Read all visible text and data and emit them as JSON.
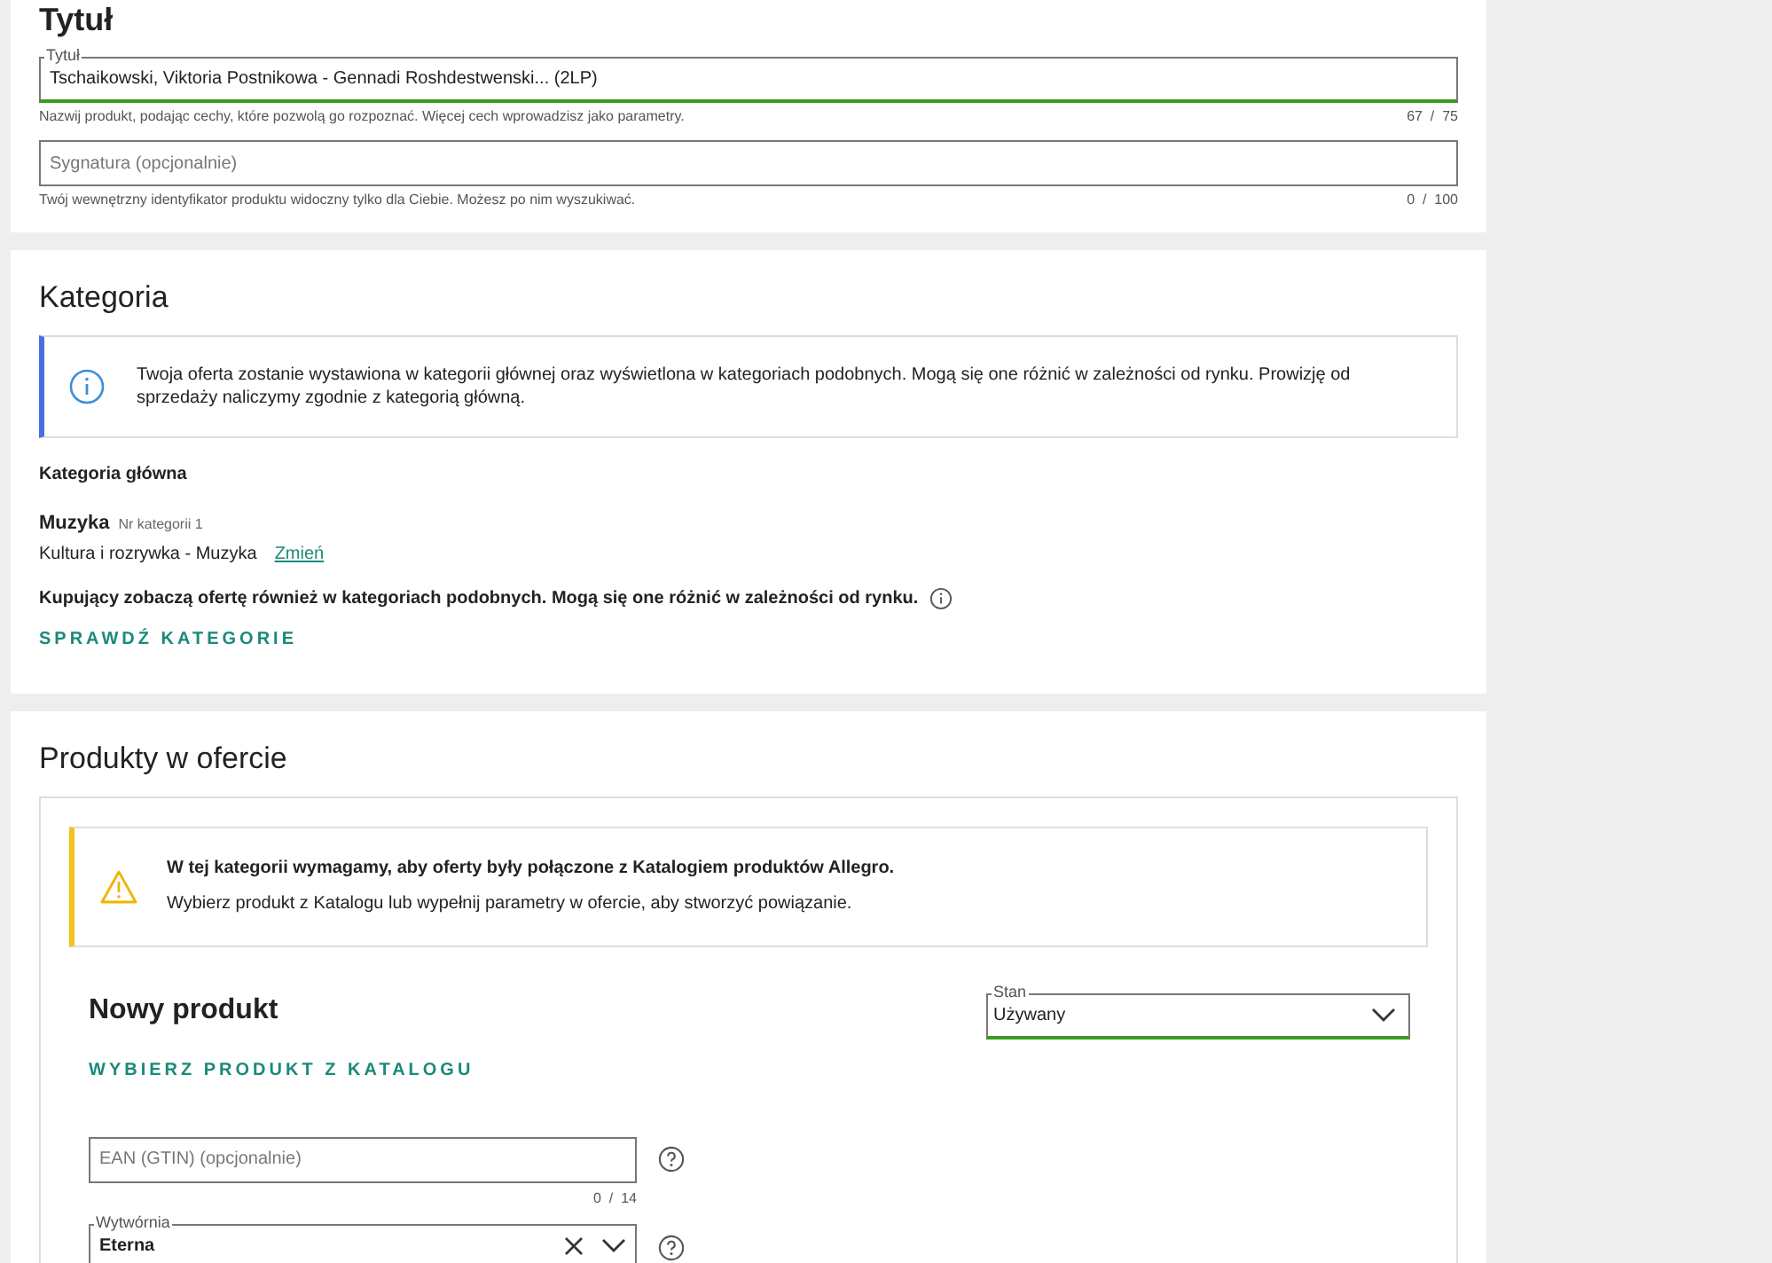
{
  "title_section": {
    "heading": "Tytuł",
    "title_field": {
      "label": "Tytuł",
      "value": "Tschaikowski, Viktoria Postnikowa - Gennadi Roshdestwenski... (2LP)",
      "hint": "Nazwij produkt, podając cechy, które pozwolą go rozpoznać. Więcej cech wprowadzisz jako parametry.",
      "counter": "67  /  75"
    },
    "signature_field": {
      "placeholder": "Sygnatura (opcjonalnie)",
      "hint": "Twój wewnętrzny identyfikator produktu widoczny tylko dla Ciebie. Możesz po nim wyszukiwać.",
      "counter": "0  /  100"
    }
  },
  "category_section": {
    "heading": "Kategoria",
    "info": "Twoja oferta zostanie wystawiona w kategorii głównej oraz wyświetlona w kategoriach podobnych. Mogą się one różnić w zależności od rynku. Prowizję od sprzedaży naliczymy zgodnie z kategorią główną.",
    "main_label": "Kategoria główna",
    "category_name": "Muzyka",
    "category_number": "Nr kategorii 1",
    "category_path": "Kultura i rozrywka - Muzyka",
    "change_link": "Zmień",
    "similar_note": "Kupujący zobaczą ofertę również w kategoriach podobnych. Mogą się one różnić w zależności od rynku.",
    "check_button": "SPRAWDŹ KATEGORIE"
  },
  "products_section": {
    "heading": "Produkty w ofercie",
    "warning_title": "W tej kategorii wymagamy, aby oferty były połączone z Katalogiem produktów Allegro.",
    "warning_text": "Wybierz produkt z Katalogu lub wypełnij parametry w ofercie, aby stworzyć powiązanie.",
    "new_product": "Nowy produkt",
    "catalog_button": "WYBIERZ PRODUKT Z KATALOGU",
    "condition": {
      "label": "Stan",
      "value": "Używany"
    },
    "ean": {
      "placeholder": "EAN (GTIN) (opcjonalnie)",
      "counter": "0  /  14"
    },
    "label_field": {
      "label": "Wytwórnia",
      "value": "Eterna"
    }
  }
}
